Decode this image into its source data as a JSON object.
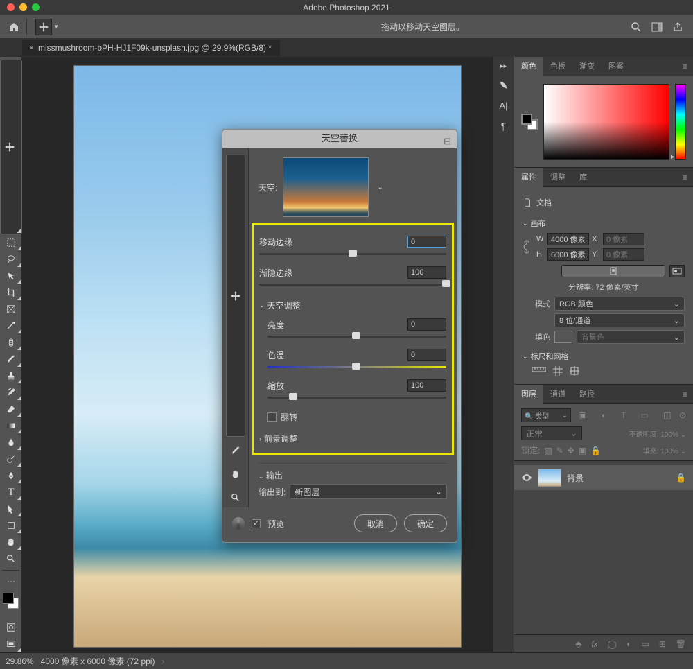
{
  "app_title": "Adobe Photoshop 2021",
  "options_hint": "拖动以移动天空图层。",
  "tab": {
    "label": "missmushroom-bPH-HJ1F09k-unsplash.jpg @ 29.9%(RGB/8) *"
  },
  "dialog": {
    "title": "天空替换",
    "sky_label": "天空:",
    "shift_edge_label": "移动边缘",
    "shift_edge_value": "0",
    "fade_edge_label": "渐隐边缘",
    "fade_edge_value": "100",
    "sky_adj_header": "天空调整",
    "brightness_label": "亮度",
    "brightness_value": "0",
    "temp_label": "色温",
    "temp_value": "0",
    "scale_label": "缩放",
    "scale_value": "100",
    "flip_label": "翻转",
    "fg_adj_header": "前景调整",
    "output_header": "输出",
    "output_to_label": "输出到:",
    "output_to_value": "新图层",
    "preview_label": "预览",
    "cancel": "取消",
    "ok": "确定"
  },
  "panels": {
    "color": {
      "tabs": [
        "颜色",
        "色板",
        "渐变",
        "图案"
      ]
    },
    "properties": {
      "tabs": [
        "属性",
        "调整",
        "库"
      ],
      "doc_label": "文档",
      "canvas_header": "画布",
      "w_label": "W",
      "w_value": "4000 像素",
      "x_label": "X",
      "x_value": "0 像素",
      "h_label": "H",
      "h_value": "6000 像素",
      "y_label": "Y",
      "y_value": "0 像素",
      "resolution": "分辨率: 72 像素/英寸",
      "mode_label": "模式",
      "mode_value": "RGB 颜色",
      "depth_value": "8 位/通道",
      "fill_label": "填色",
      "fill_value": "背景色",
      "rulers_header": "标尺和网格"
    },
    "layers": {
      "tabs": [
        "图层",
        "通道",
        "路径"
      ],
      "filter_label": "类型",
      "mode_value": "正常",
      "opacity_label": "不透明度:",
      "opacity_value": "100%",
      "lock_label": "锁定:",
      "fill_label": "填充:",
      "fill_value": "100%",
      "layer_bg": "背景"
    }
  },
  "status": {
    "zoom": "29.86%",
    "dims": "4000 像素 x 6000 像素 (72 ppi)"
  }
}
